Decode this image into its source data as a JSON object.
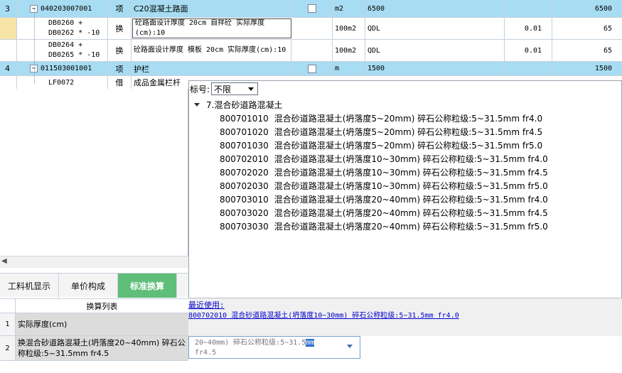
{
  "grid": {
    "rows": [
      {
        "num": "3",
        "code": "040203007001",
        "type": "项",
        "desc": "C20混凝土路面",
        "unit": "m2",
        "qty": "6500",
        "rate": "",
        "amount": "6500",
        "highlight": true,
        "expander": "−"
      },
      {
        "num": "",
        "code": "DB0260 + DB0262 * -10",
        "type": "换",
        "desc": "砼路面设计厚度 20cm 自拌砼  实际厚度(cm):10",
        "unit": "100m2",
        "qty": "QDL",
        "rate": "0.01",
        "amount": "65",
        "highlight": false
      },
      {
        "num": "",
        "code": "DB0264 + DB0265 * -10",
        "type": "换",
        "desc": "砼路面设计厚度 模板 20cm  实际厚度(cm):10",
        "unit": "100m2",
        "qty": "QDL",
        "rate": "0.01",
        "amount": "65",
        "highlight": false
      },
      {
        "num": "4",
        "code": "011503001001",
        "type": "项",
        "desc": "护栏",
        "unit": "m",
        "qty": "1500",
        "rate": "",
        "amount": "1500",
        "highlight": true,
        "expander": "−"
      },
      {
        "num": "",
        "code": "LF0072",
        "type": "借",
        "desc": "成品金属栏杆",
        "unit": "",
        "qty": "",
        "rate": "",
        "amount": "",
        "highlight": false
      }
    ]
  },
  "popup": {
    "filter_label": "标号:",
    "filter_value": "不限",
    "group": "7.混合砂道路混凝土",
    "items": [
      {
        "code": "800701010",
        "name": "混合砂道路混凝土(坍落度5~20mm) 碎石公称粒级:5~31.5mm fr4.0"
      },
      {
        "code": "800701020",
        "name": "混合砂道路混凝土(坍落度5~20mm) 碎石公称粒级:5~31.5mm fr4.5"
      },
      {
        "code": "800701030",
        "name": "混合砂道路混凝土(坍落度5~20mm) 碎石公称粒级:5~31.5mm fr5.0"
      },
      {
        "code": "800702010",
        "name": "混合砂道路混凝土(坍落度10~30mm) 碎石公称粒级:5~31.5mm fr4.0"
      },
      {
        "code": "800702020",
        "name": "混合砂道路混凝土(坍落度10~30mm) 碎石公称粒级:5~31.5mm fr4.5"
      },
      {
        "code": "800702030",
        "name": "混合砂道路混凝土(坍落度10~30mm) 碎石公称粒级:5~31.5mm fr5.0"
      },
      {
        "code": "800703010",
        "name": "混合砂道路混凝土(坍落度20~40mm) 碎石公称粒级:5~31.5mm fr4.0"
      },
      {
        "code": "800703020",
        "name": "混合砂道路混凝土(坍落度20~40mm) 碎石公称粒级:5~31.5mm fr4.5"
      },
      {
        "code": "800703030",
        "name": "混合砂道路混凝土(坍落度20~40mm) 碎石公称粒级:5~31.5mm fr5.0"
      }
    ],
    "recent_label": "最近使用:",
    "recent_item": "800702010 混合砂道路混凝土(坍落度10~30mm) 碎石公称粒级:5~31.5mm fr4.0"
  },
  "tabs": [
    {
      "label": "工料机显示"
    },
    {
      "label": "单价构成"
    },
    {
      "label": "标准换算"
    }
  ],
  "conversion": {
    "header": "换算列表",
    "rows": [
      {
        "num": "1",
        "text": "实际厚度(cm)"
      },
      {
        "num": "2",
        "text": "换混合砂道路混凝土(坍落度20~40mm) 碎石公称粒级:5~31.5mm fr4.5"
      }
    ]
  },
  "editbox": {
    "line1_pre": "20~40mm) 碎石公称粒级:5~31.5",
    "line1_sel": "mm",
    "line2": "fr4.5"
  },
  "icons": {
    "expander": "minus-box-icon",
    "dropdown": "chevron-down-icon",
    "tree_toggle": "triangle-down-icon"
  }
}
